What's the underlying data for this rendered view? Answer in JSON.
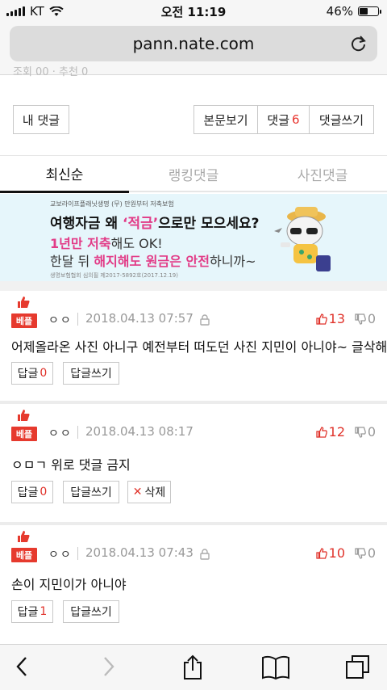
{
  "status_bar": {
    "carrier": "KT",
    "time": "오전 11:19",
    "battery_percent": "46%",
    "battery_level": 0.46
  },
  "browser": {
    "url": "pann.nate.com",
    "reload_icon": "reload-icon"
  },
  "page": {
    "cut_off_text": "조회 00 · 추천 0",
    "buttons": {
      "my_comments": "내 댓글",
      "view_original": "본문보기",
      "comments_label": "댓글",
      "comments_count": "6",
      "write_comment": "댓글쓰기"
    },
    "tabs": [
      {
        "label": "최신순",
        "active": true
      },
      {
        "label": "랭킹댓글",
        "active": false
      },
      {
        "label": "사진댓글",
        "active": false
      }
    ],
    "ad": {
      "brand": "교보라이프플래닛생명 (무) 만원부터 저축보험",
      "line1_pre": "여행자금 왜 ",
      "line1_highlight": "‘적금’",
      "line1_post": "으로만 모으세요?",
      "line2_highlight": "1년만 저축",
      "line2_post": "해도 OK!",
      "line3_pre": "한달 뒤 ",
      "line3_highlight1": "해지해도 원금은 안전",
      "line3_post": "하니까~",
      "fine_print": "생명보험협회 심의필 제2017-5892호(2017.12.19)"
    },
    "best_label": "베플",
    "reply_label": "답글",
    "write_reply_label": "답글쓰기",
    "delete_label": "삭제",
    "comments": [
      {
        "author": "ㅇㅇ",
        "date": "2018.04.13 07:57",
        "has_lock": true,
        "upvotes": "13",
        "downvotes": "0",
        "text": "어제올라온 사진 아니구 예전부터 떠도던 사진 지민이 아니야~ 글삭해줭",
        "reply_count": "0",
        "has_delete": false
      },
      {
        "author": "ㅇㅇ",
        "date": "2018.04.13 08:17",
        "has_lock": false,
        "upvotes": "12",
        "downvotes": "0",
        "text": "ㅇㅁㄱ 위로 댓글 금지",
        "reply_count": "0",
        "has_delete": true
      },
      {
        "author": "ㅇㅇ",
        "date": "2018.04.13 07:43",
        "has_lock": true,
        "upvotes": "10",
        "downvotes": "0",
        "text": "손이 지민이가 아니야",
        "reply_count": "1",
        "has_delete": false
      }
    ]
  },
  "toolbar": {
    "icons": [
      "back-icon",
      "forward-icon",
      "share-icon",
      "bookmarks-icon",
      "tabs-icon"
    ]
  },
  "colors": {
    "accent_red": "#e0322a",
    "best_badge": "#e63a2e",
    "ad_background": "#e6f6fb",
    "ad_pink": "#e23b87"
  }
}
